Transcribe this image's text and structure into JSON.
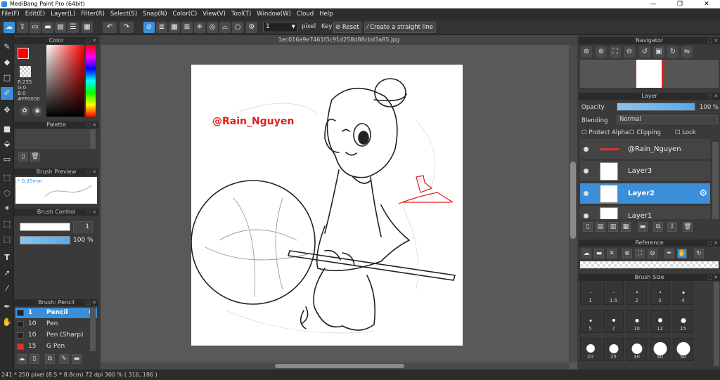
{
  "window": {
    "title": "MediBang Paint Pro (64bit)",
    "minimize": "—",
    "maximize": "❐",
    "close": "✕"
  },
  "menu": [
    "File(F)",
    "Edit(E)",
    "Layer(L)",
    "Filter(R)",
    "Select(S)",
    "Snap(N)",
    "Color(C)",
    "View(V)",
    "Tool(T)",
    "Window(W)",
    "Cloud",
    "Help"
  ],
  "toolbar": {
    "size_value": "1",
    "size_unit": "pixel",
    "key_label": "Key",
    "reset_label": "Reset",
    "straight_line_label": "Create a straight line"
  },
  "document": {
    "filename": "1ec016a9e7461f3c91d258d88cbd3a85.jpg",
    "watermark": "@Rain_Nguyen"
  },
  "color_panel": {
    "title": "Color",
    "r": "R:255",
    "g": "G:0",
    "b": "B:0",
    "hex": "#FF0000",
    "accent": "#ff0000"
  },
  "palette_panel": {
    "title": "Palette"
  },
  "brush_preview": {
    "title": "Brush Preview",
    "size": "* 0.35mm"
  },
  "brush_control": {
    "title": "Brush Control",
    "size_value": "1",
    "opacity_value": "100 %",
    "opacity_level": 1.0
  },
  "brush_list": {
    "title": "Brush: Pencil",
    "items": [
      {
        "size": "1",
        "name": "Pencil",
        "color": "#222222",
        "selected": true
      },
      {
        "size": "10",
        "name": "Pen",
        "color": "#222222",
        "selected": false
      },
      {
        "size": "10",
        "name": "Pen (Sharp)",
        "color": "#222222",
        "selected": false
      },
      {
        "size": "15",
        "name": "G Pen",
        "color": "#e03030",
        "selected": false
      }
    ]
  },
  "navigator": {
    "title": "Navigator"
  },
  "layer_panel": {
    "title": "Layer",
    "opacity_label": "Opacity",
    "opacity_value": "100 %",
    "opacity_level": 1.0,
    "blending_label": "Blending",
    "blending_value": "Normal",
    "protect_alpha": "Protect Alpha",
    "clipping": "Clipping",
    "lock": "Lock",
    "layers": [
      {
        "name": "@Rain_Nguyen",
        "selected": false
      },
      {
        "name": "Layer3",
        "selected": false
      },
      {
        "name": "Layer2",
        "selected": true
      },
      {
        "name": "Layer1",
        "selected": false
      }
    ]
  },
  "reference": {
    "title": "Reference"
  },
  "brush_size": {
    "title": "Brush Size",
    "sizes": [
      "1",
      "1.5",
      "2",
      "3",
      "4",
      "5",
      "7",
      "10",
      "12",
      "15",
      "20",
      "25",
      "30",
      "40",
      "50"
    ]
  },
  "status": {
    "text": "241 * 250 pixel  (8.5 * 8.8cm)  72 dpi  300 %  ( 316, 186 )"
  }
}
